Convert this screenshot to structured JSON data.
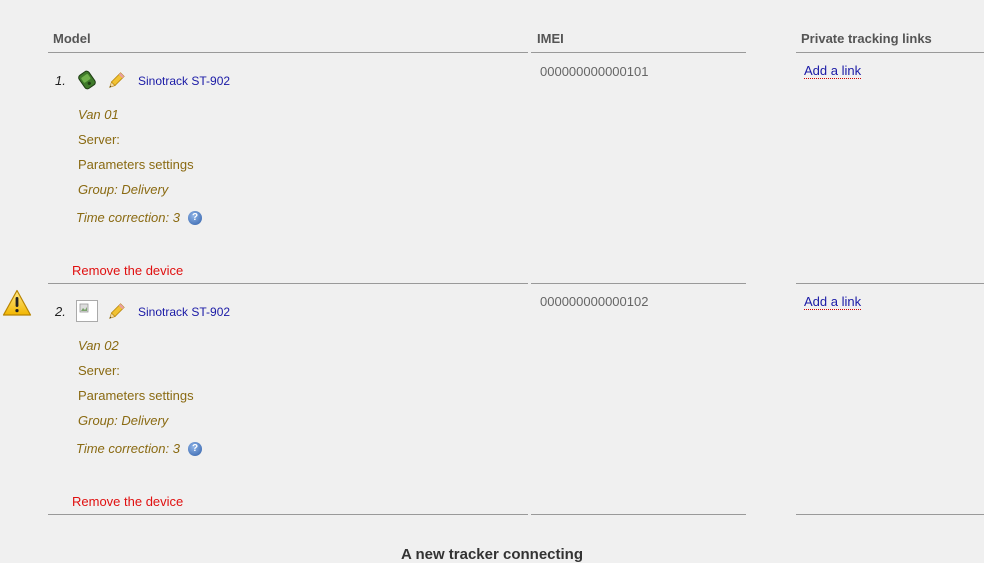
{
  "columns": {
    "model": "Model",
    "imei": "IMEI",
    "links": "Private tracking links"
  },
  "devices": [
    {
      "index": "1.",
      "model": "Sinotrack ST-902",
      "name": "Van 01",
      "server": "Server:",
      "params": "Parameters settings",
      "group": "Group: Delivery",
      "time_correction": "Time correction: 3",
      "remove": "Remove the device",
      "imei": "000000000000101",
      "add_link": "Add a link",
      "icon": "gps-tracker-icon"
    },
    {
      "index": "2.",
      "model": "Sinotrack ST-902",
      "name": "Van 02",
      "server": "Server:",
      "params": "Parameters settings",
      "group": "Group: Delivery",
      "time_correction": "Time correction: 3",
      "remove": "Remove the device",
      "imei": "000000000000102",
      "add_link": "Add a link",
      "icon": "broken-image-icon",
      "warning": true
    }
  ],
  "help_glyph": "?",
  "footer_title": "A new tracker connecting"
}
